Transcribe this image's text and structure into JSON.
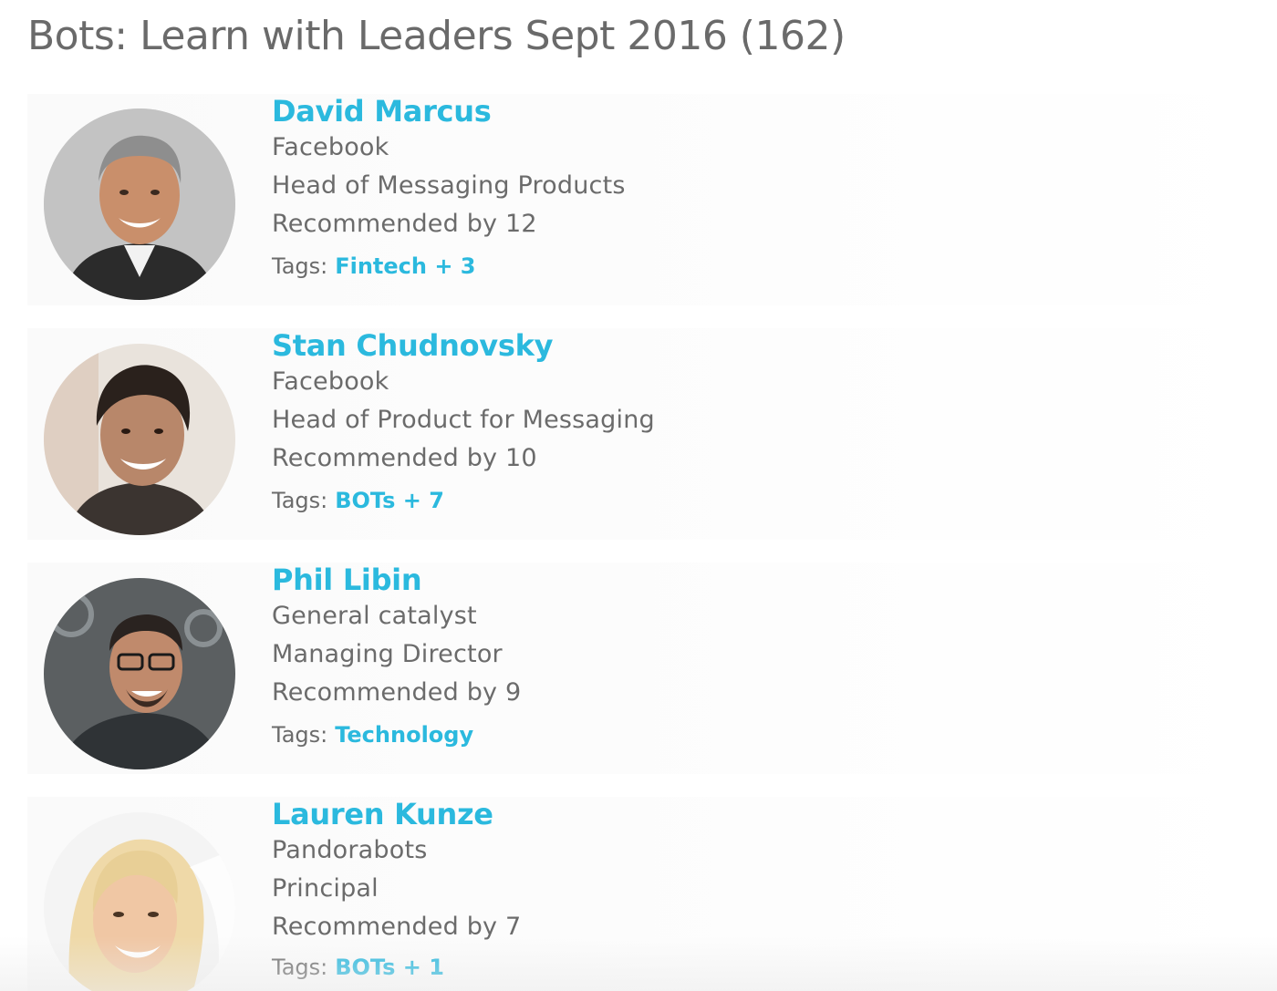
{
  "page": {
    "title": "Bots: Learn with Leaders Sept 2016 (162)"
  },
  "colors": {
    "accent": "#2bb9de",
    "text": "#6b6b6b",
    "title": "#6a6a6a"
  },
  "people": [
    {
      "name": "David Marcus",
      "company": "Facebook",
      "role": "Head of Messaging Products",
      "recommended": "Recommended by 12",
      "tags_label": "Tags:",
      "tags_value": "Fintech + 3",
      "avatar_icon": "person-photo-icon"
    },
    {
      "name": "Stan Chudnovsky",
      "company": "Facebook",
      "role": "Head of Product for Messaging",
      "recommended": "Recommended by 10",
      "tags_label": "Tags:",
      "tags_value": "BOTs + 7",
      "avatar_icon": "person-photo-icon"
    },
    {
      "name": "Phil Libin",
      "company": "General catalyst",
      "role": "Managing Director",
      "recommended": "Recommended by 9",
      "tags_label": "Tags:",
      "tags_value": "Technology",
      "avatar_icon": "person-photo-icon"
    },
    {
      "name": "Lauren Kunze",
      "company": "Pandorabots",
      "role": "Principal",
      "recommended": "Recommended by 7",
      "tags_label": "Tags:",
      "tags_value": "BOTs + 1",
      "avatar_icon": "person-photo-icon"
    }
  ]
}
